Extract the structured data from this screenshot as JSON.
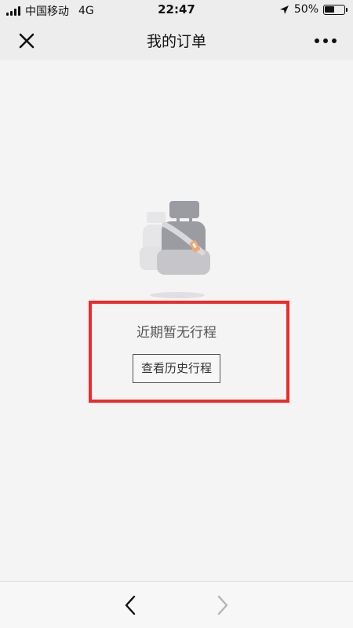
{
  "status_bar": {
    "carrier": "中国移动",
    "network": "4G",
    "time": "22:47",
    "battery_percent": "50%",
    "battery_level": 0.5,
    "icons": [
      "signal-icon",
      "location-arrow-icon",
      "battery-icon"
    ]
  },
  "nav": {
    "title": "我的订单",
    "close_icon": "close-icon",
    "more_icon": "more-dots-icon"
  },
  "empty_state": {
    "illustration": "car-seat-icon",
    "message": "近期暂无行程",
    "button_label": "查看历史行程"
  },
  "highlight_color": "#ee2b2b",
  "toolbar": {
    "back_icon": "chevron-left-icon",
    "forward_icon": "chevron-right-icon",
    "forward_enabled": false
  }
}
